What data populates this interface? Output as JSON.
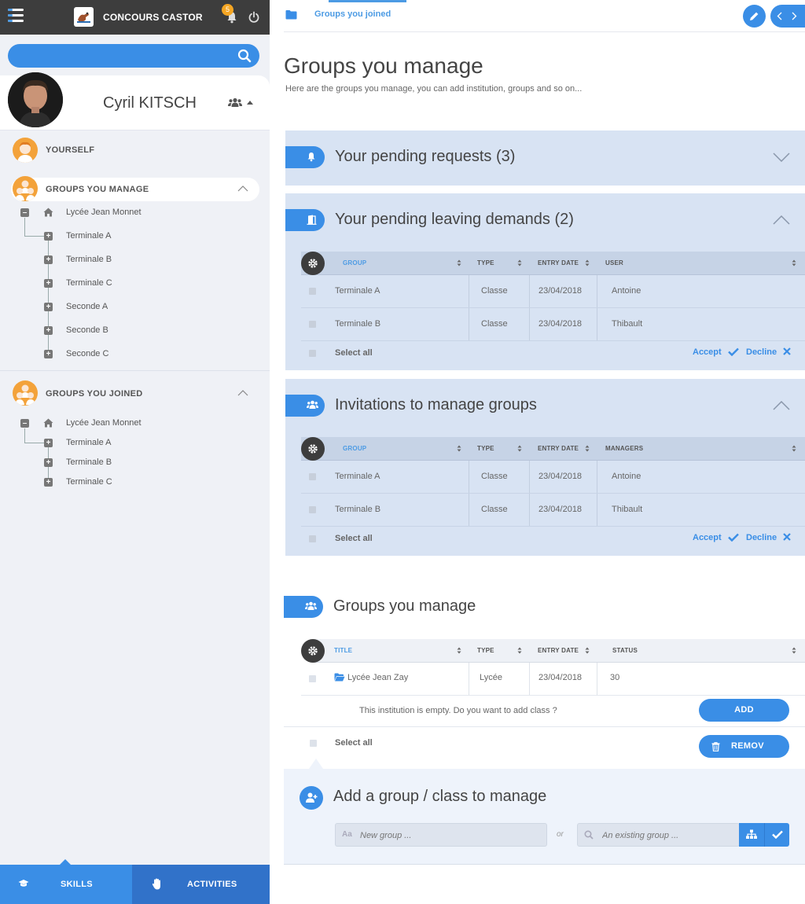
{
  "app": {
    "brand": "CONCOURS CASTOR",
    "notif_count": "5"
  },
  "search": {
    "placeholder": ""
  },
  "user": {
    "name": "Cyril KITSCH"
  },
  "sidebar": {
    "yourself": "YOURSELF",
    "manage": {
      "label": "GROUPS YOU MANAGE",
      "root": "Lycée Jean Monnet",
      "children": [
        "Terminale A",
        "Terminale B",
        "Terminale C",
        "Seconde A",
        "Seconde B",
        "Seconde C"
      ]
    },
    "joined": {
      "label": "GROUPS YOU JOINED",
      "root": "Lycée Jean Monnet",
      "children": [
        "Terminale A",
        "Terminale B",
        "Terminale C"
      ]
    },
    "bottom": {
      "skills": "SKILLS",
      "activities": "ACTIVITIES"
    }
  },
  "breadcrumb": {
    "label": "Groups you joined"
  },
  "page": {
    "title": "Groups you manage",
    "subtitle": "Here are the groups you manage, you can add institution, groups and so on..."
  },
  "pending": {
    "title": "Your pending requests (3)"
  },
  "leaving": {
    "title": "Your pending leaving demands (2)",
    "headers": [
      "GROUP",
      "TYPE",
      "ENTRY DATE",
      "USER"
    ],
    "rows": [
      {
        "group": "Terminale A",
        "type": "Classe",
        "date": "23/04/2018",
        "user": "Antoine"
      },
      {
        "group": "Terminale B",
        "type": "Classe",
        "date": "23/04/2018",
        "user": "Thibault"
      }
    ],
    "select_all": "Select all",
    "accept": "Accept",
    "decline": "Decline"
  },
  "invitations": {
    "title": "Invitations to manage groups",
    "headers": [
      "GROUP",
      "TYPE",
      "ENTRY DATE",
      "MANAGERS"
    ],
    "rows": [
      {
        "group": "Terminale A",
        "type": "Classe",
        "date": "23/04/2018",
        "user": "Antoine"
      },
      {
        "group": "Terminale B",
        "type": "Classe",
        "date": "23/04/2018",
        "user": "Thibault"
      }
    ],
    "select_all": "Select all",
    "accept": "Accept",
    "decline": "Decline"
  },
  "managed": {
    "title": "Groups you manage",
    "headers": [
      "TITLE",
      "TYPE",
      "ENTRY DATE",
      "STATUS"
    ],
    "row": {
      "title": "Lycée Jean Zay",
      "type": "Lycée",
      "date": "23/04/2018",
      "status": "30"
    },
    "empty_msg": "This institution is empty. Do you want to add class ?",
    "add": "ADD",
    "select_all": "Select all",
    "remove": "REMOV"
  },
  "add_group": {
    "title": "Add a group / class to manage",
    "new_placeholder": "New group ...",
    "or": "or",
    "existing_placeholder": "An existing group ..."
  },
  "colors": {
    "accent": "#3a8ee6",
    "card": "#d8e3f3",
    "dark": "#3d3d3d",
    "orange": "#f3a23a"
  }
}
